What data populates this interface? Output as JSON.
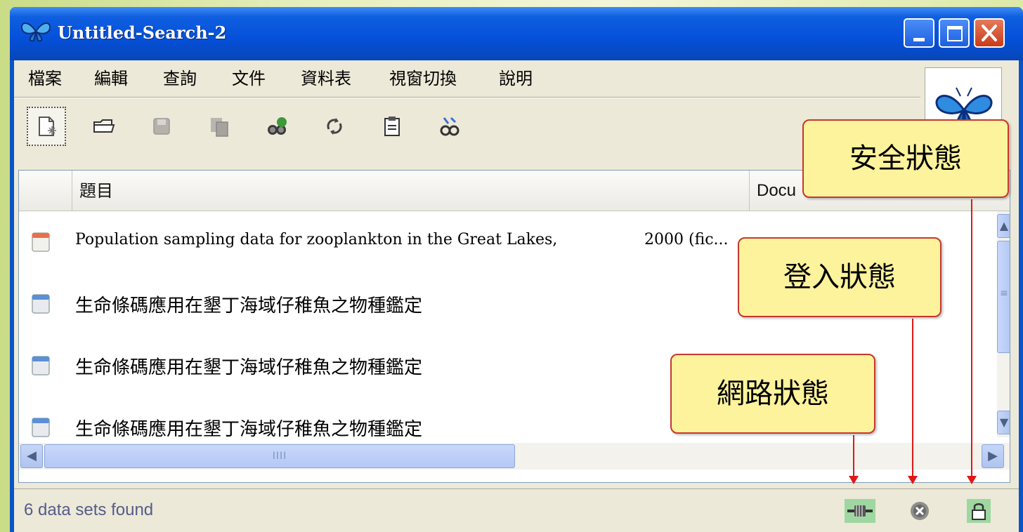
{
  "window": {
    "title": "Untitled-Search-2"
  },
  "menu": {
    "items": [
      "檔案",
      "編輯",
      "查詢",
      "文件",
      "資料表",
      "視窗切換",
      "說明"
    ]
  },
  "toolbar": {
    "tools": [
      "new-search-icon",
      "open-folder-icon",
      "save-icon",
      "copy-icon",
      "binoculars-icon",
      "refresh-icon",
      "clipboard-icon",
      "link-icon"
    ]
  },
  "table": {
    "columns": [
      "題目",
      "Docu"
    ],
    "rows": [
      {
        "title": "Population sampling data for zooplankton in the Great Lakes,",
        "doc": "2000 (fic...",
        "icon": "document-icon"
      },
      {
        "title": "生命條碼應用在墾丁海域仔稚魚之物種鑑定",
        "doc": "",
        "icon": "document-icon"
      },
      {
        "title": "生命條碼應用在墾丁海域仔稚魚之物種鑑定",
        "doc": "",
        "icon": "document-icon"
      },
      {
        "title": "生命條碼應用在墾丁海域仔稚魚之物種鑑定",
        "doc": "",
        "icon": "document-icon"
      }
    ],
    "hscroll_thumb_mark": "IIII",
    "vscroll_thumb_mark": "≡"
  },
  "status": {
    "text": "6 data sets found"
  },
  "callouts": {
    "security": "安全狀態",
    "login": "登入狀態",
    "network": "網路狀態"
  },
  "colors": {
    "titlebar": "#0550d9",
    "callout_fill": "#fdf39c",
    "arrow": "#e01818"
  }
}
